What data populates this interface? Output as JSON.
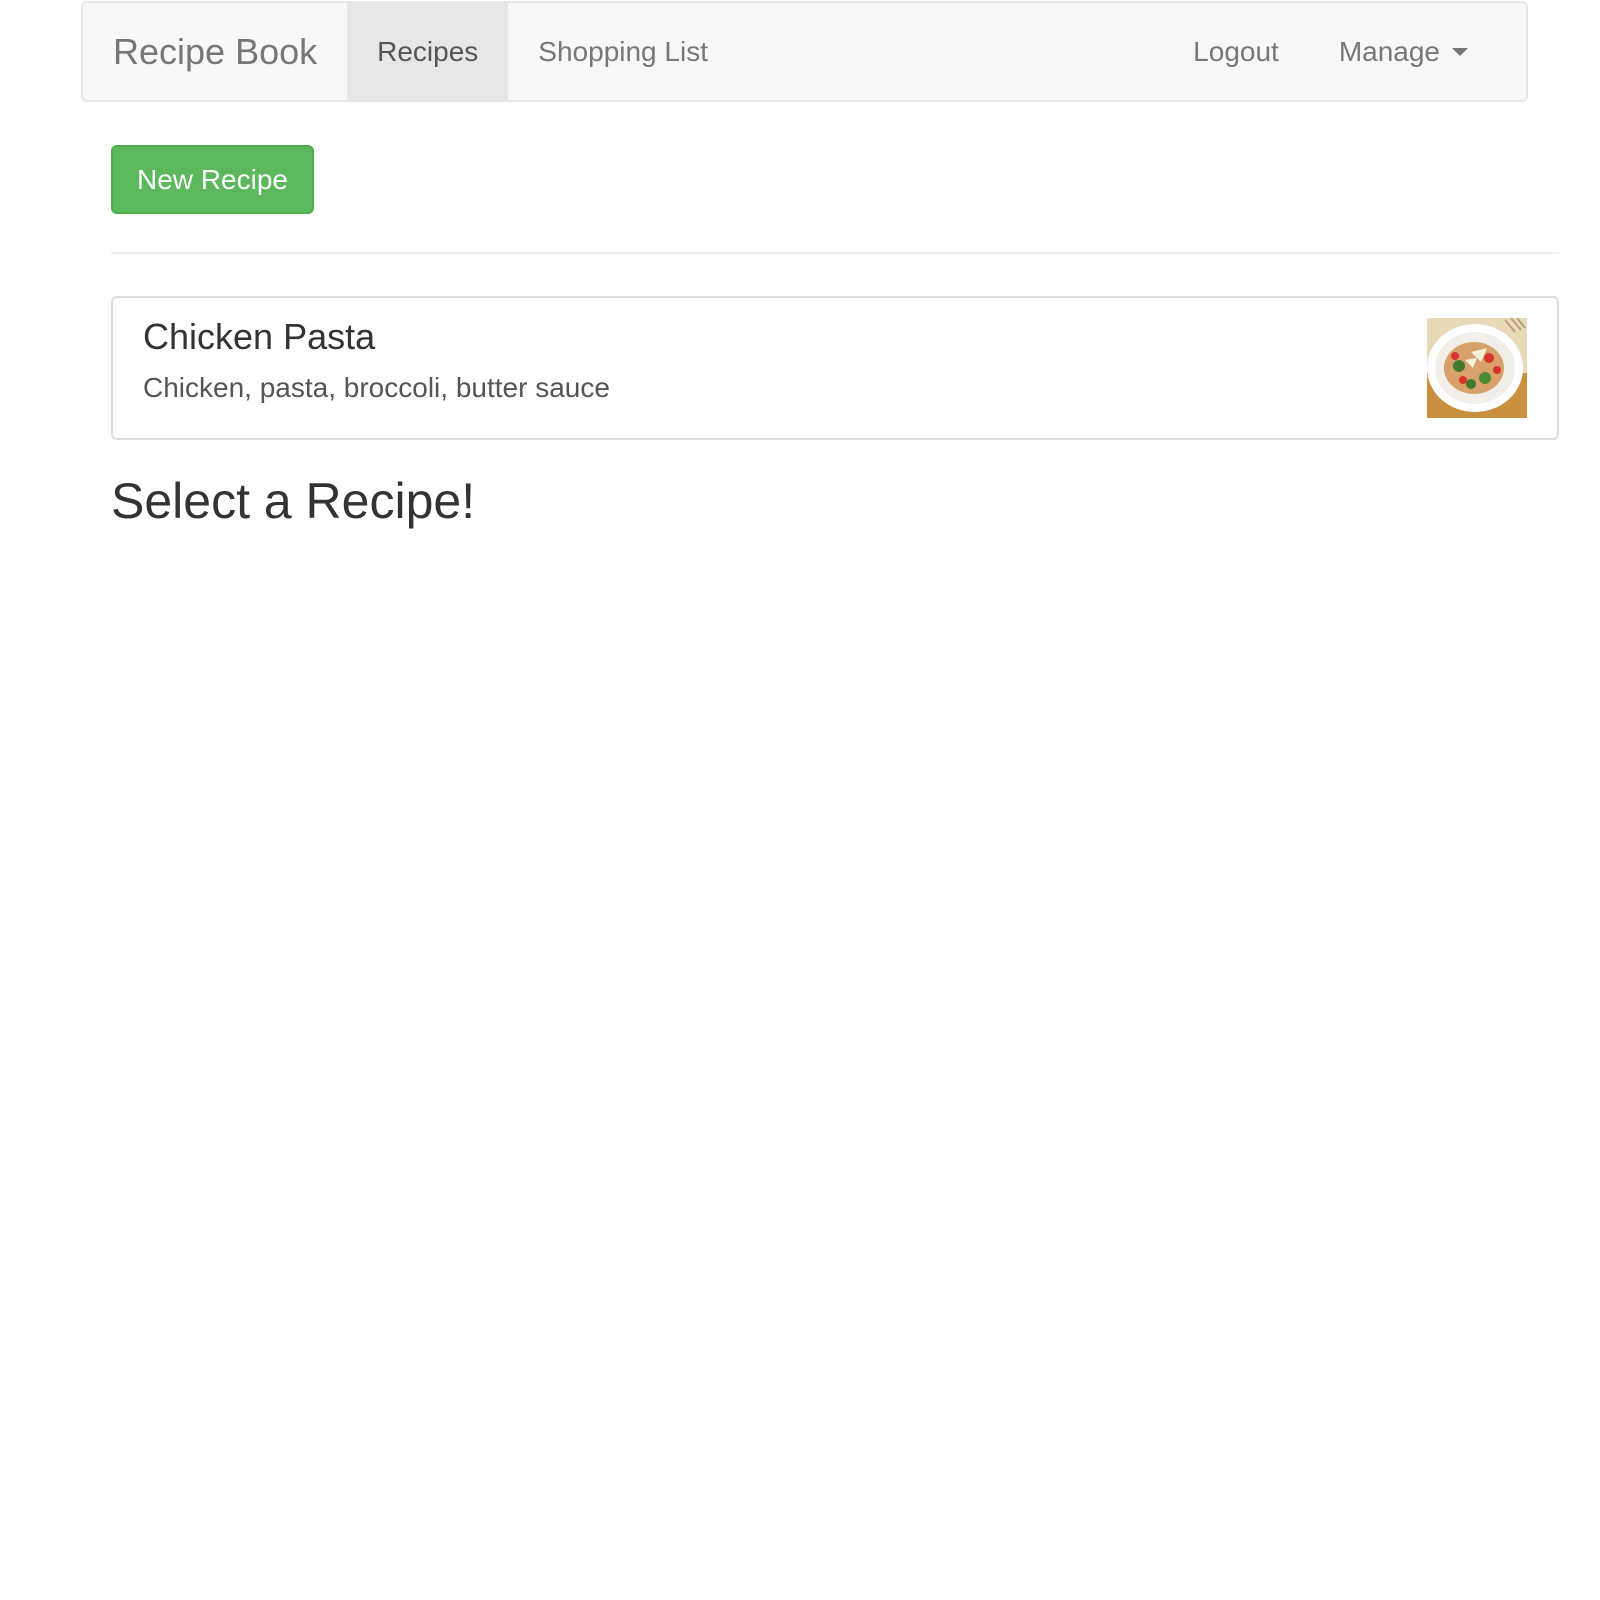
{
  "navbar": {
    "brand": "Recipe Book",
    "items": [
      {
        "label": "Recipes",
        "active": true
      },
      {
        "label": "Shopping List",
        "active": false
      }
    ],
    "right_items": [
      {
        "label": "Logout"
      },
      {
        "label": "Manage"
      }
    ]
  },
  "actions": {
    "new_recipe_label": "New Recipe"
  },
  "recipes": [
    {
      "name": "Chicken Pasta",
      "description": "Chicken, pasta, broccoli, butter sauce",
      "image_icon": "pasta-dish-photo"
    }
  ],
  "main": {
    "heading": "Select a Recipe!"
  },
  "colors": {
    "navbar_bg": "#f8f8f8",
    "active_tab_bg": "#e7e7e7",
    "success_button": "#5cb85c",
    "text_muted": "#777777"
  }
}
